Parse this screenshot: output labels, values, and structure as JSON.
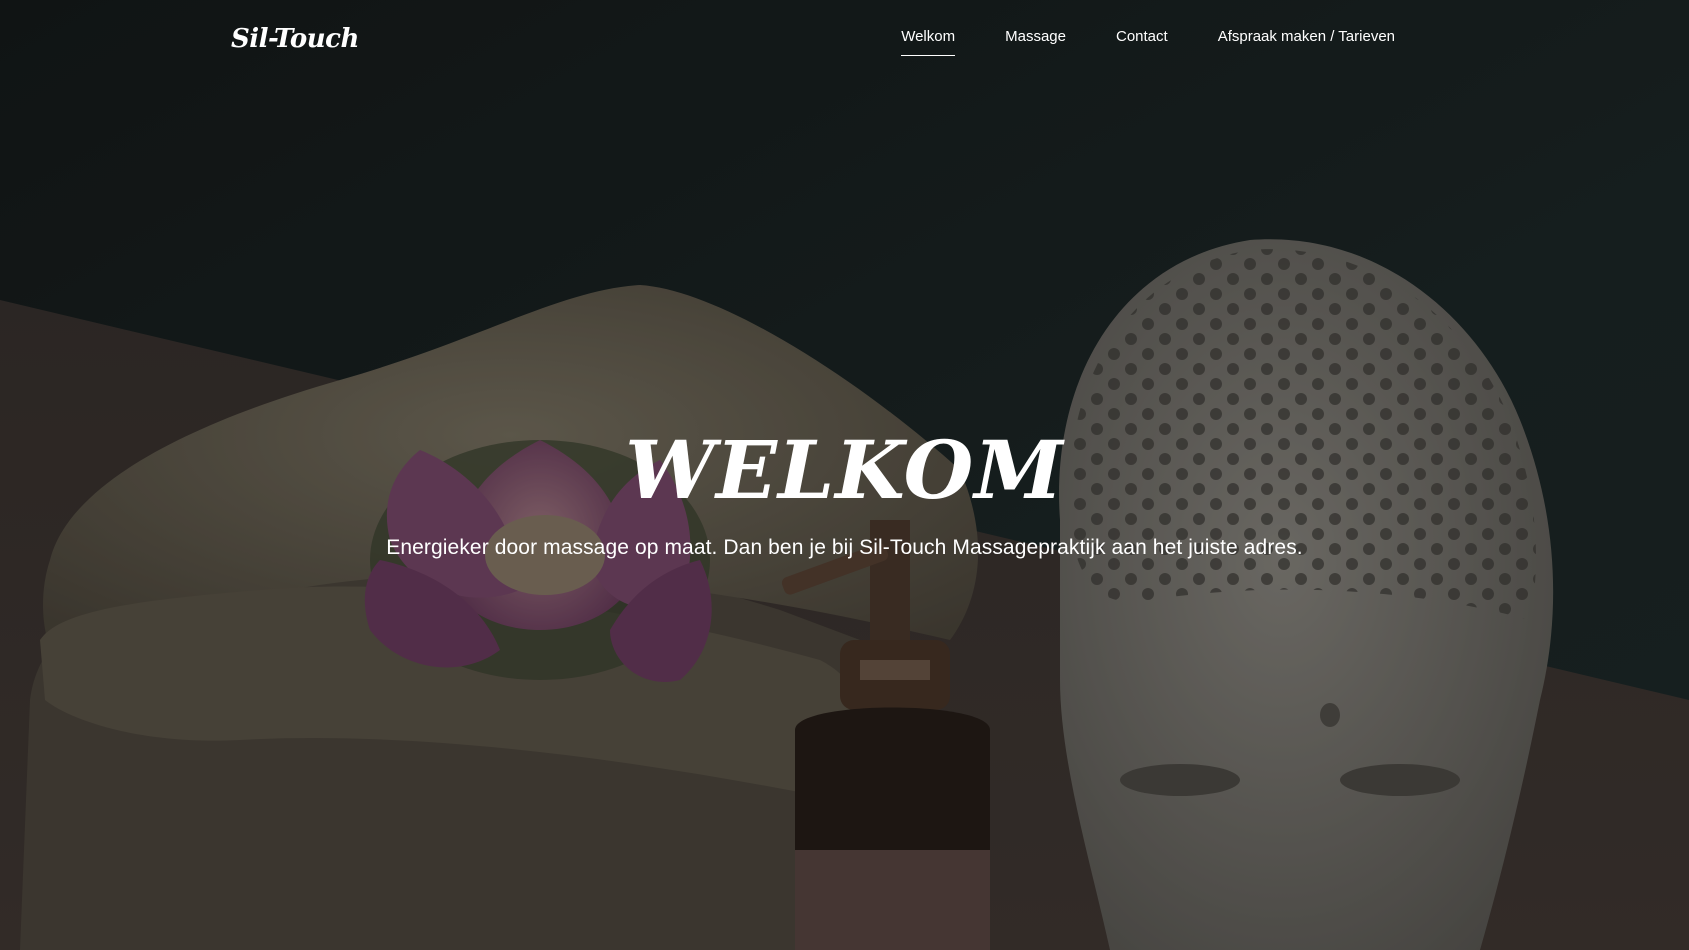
{
  "header": {
    "logo_text": "Sil-Touch",
    "nav": [
      {
        "label": "Welkom",
        "active": true
      },
      {
        "label": "Massage",
        "active": false
      },
      {
        "label": "Contact",
        "active": false
      },
      {
        "label": "Afspraak maken / Tarieven",
        "active": false
      }
    ]
  },
  "hero": {
    "title": "WELKOM",
    "subtitle": "Energieker door massage op maat. Dan ben je bij Sil-Touch Massagepraktijk aan het juiste adres.",
    "image_icons": [
      "towel-stack",
      "lotus-flower",
      "oil-pump-bottle",
      "buddha-head"
    ]
  },
  "colors": {
    "wall": "#1c2626",
    "table": "#3b3430",
    "text": "#ffffff"
  }
}
